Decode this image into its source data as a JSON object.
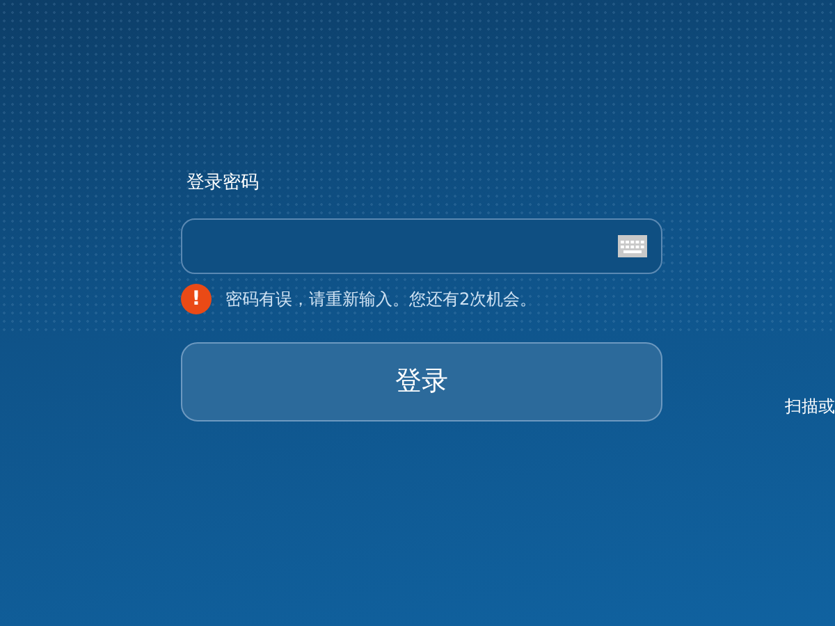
{
  "password_label": "登录密码",
  "error": {
    "icon": "!",
    "message": "密码有误，请重新输入。您还有2次机会。"
  },
  "login_button": "登录",
  "side_text": "扫描或"
}
